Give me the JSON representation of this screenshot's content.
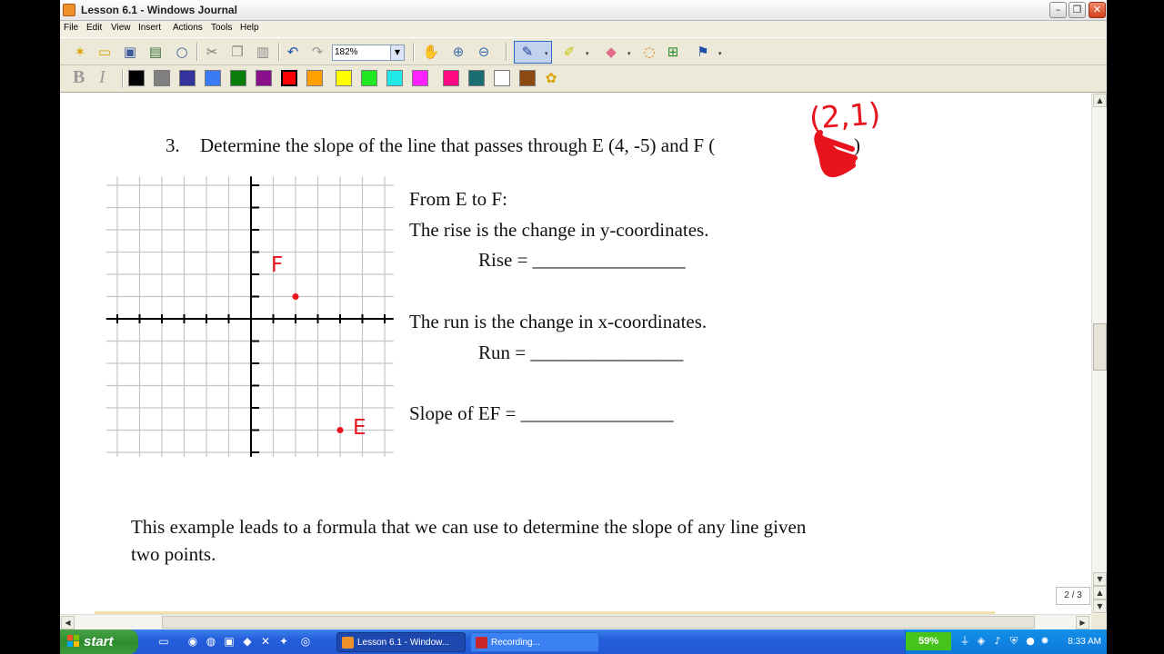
{
  "window": {
    "title": "Lesson 6.1 - Windows Journal",
    "min_glyph": "–",
    "max_glyph": "❐",
    "close_glyph": "✕"
  },
  "menu": [
    "File",
    "Edit",
    "View",
    "Insert",
    "Actions",
    "Tools",
    "Help"
  ],
  "toolbar": {
    "zoom_value": "182%",
    "zoom_drop_glyph": "▼",
    "dropdown_glyph": "▾",
    "bold_label": "B",
    "italic_label": "I"
  },
  "palette": [
    "#000000",
    "#7f7f7f",
    "#33349b",
    "#3a7bf2",
    "#0b7d0b",
    "#8a0f8a",
    "#ff0000",
    "#ff9f00",
    "#ffff00",
    "#22e822",
    "#22e8e8",
    "#ff22ff",
    "#ff0a80",
    "#1a6e70",
    "#ffffff",
    "#8c4a10"
  ],
  "selected_color": "#ff0000",
  "ink_color": "#e8131c",
  "document": {
    "problem_number": "3.",
    "problem_text": "Determine the slope of the line that passes through E (4, -5) and F (",
    "problem_close": ")",
    "annotation_pair": "(2,1)",
    "label_f": "F",
    "label_e": "E",
    "from_to": "From E to F:",
    "rise_explain": "The rise is the change in y-coordinates.",
    "rise_label": "Rise = ________________",
    "run_explain": "The run is the change in x-coordinates.",
    "run_label": "Run = ________________",
    "slope_label": "Slope of EF = ________________",
    "conclusion_line1": "This example leads to a formula that we can use to determine the slope of any line given",
    "conclusion_line2": "two points."
  },
  "grid": {
    "x_range": [
      -6,
      6
    ],
    "y_range": [
      -6,
      6
    ],
    "point_f": [
      2,
      1
    ],
    "point_e": [
      4,
      -5
    ]
  },
  "scroll": {
    "up": "▲",
    "down": "▼",
    "left": "◀",
    "right": "▶",
    "page_up": "▲",
    "page_down": "▼"
  },
  "page_indicator": "2 / 3",
  "taskbar": {
    "start_label": "start",
    "tasks": [
      "Lesson 6.1 - Window...",
      "Recording..."
    ],
    "battery": "59%",
    "clock": "8:33 AM"
  }
}
